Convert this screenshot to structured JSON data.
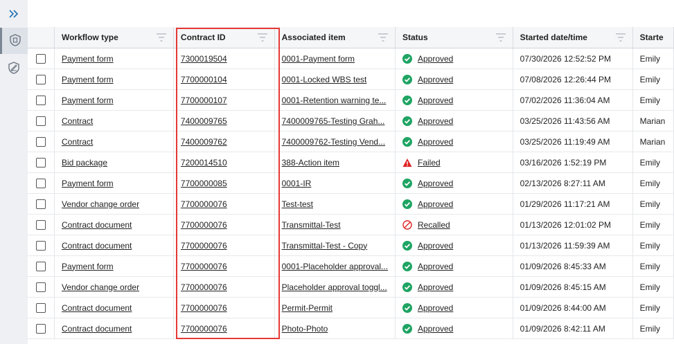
{
  "sidebar": {
    "expand_icon": "double-chevron-right-icon",
    "nav": [
      {
        "name": "workflow-nav",
        "icon": "shield-document-icon",
        "active": true
      },
      {
        "name": "sign-nav",
        "icon": "pen-signature-icon",
        "active": false
      }
    ]
  },
  "table": {
    "headers": {
      "workflow_type": "Workflow type",
      "contract_id": "Contract ID",
      "associated_item": "Associated item",
      "status": "Status",
      "started": "Started date/time",
      "started_by": "Starte"
    },
    "rows": [
      {
        "workflow_type": "Payment form",
        "contract_id": "7300019504",
        "associated_item": "0001-Payment form",
        "status": "Approved",
        "status_kind": "approved",
        "started": "07/30/2026 12:52:52 PM",
        "started_by": "Emily"
      },
      {
        "workflow_type": "Payment form",
        "contract_id": "7700000104",
        "associated_item": "0001-Locked WBS test",
        "status": "Approved",
        "status_kind": "approved",
        "started": "07/08/2026 12:26:44 PM",
        "started_by": "Emily"
      },
      {
        "workflow_type": "Payment form",
        "contract_id": "7700000107",
        "associated_item": "0001-Retention warning te...",
        "status": "Approved",
        "status_kind": "approved",
        "started": "07/02/2026 11:36:04 AM",
        "started_by": "Emily"
      },
      {
        "workflow_type": "Contract",
        "contract_id": "7400009765",
        "associated_item": "7400009765-Testing Grah...",
        "status": "Approved",
        "status_kind": "approved",
        "started": "03/25/2026 11:43:56 AM",
        "started_by": "Marian"
      },
      {
        "workflow_type": "Contract",
        "contract_id": "7400009762",
        "associated_item": "7400009762-Testing Vend...",
        "status": "Approved",
        "status_kind": "approved",
        "started": "03/25/2026 11:19:49 AM",
        "started_by": "Marian"
      },
      {
        "workflow_type": "Bid package",
        "contract_id": "7200014510",
        "associated_item": "388-Action item",
        "status": "Failed",
        "status_kind": "failed",
        "started": "03/16/2026 1:52:19 PM",
        "started_by": "Emily"
      },
      {
        "workflow_type": "Payment form",
        "contract_id": "7700000085",
        "associated_item": "0001-IR",
        "status": "Approved",
        "status_kind": "approved",
        "started": "02/13/2026 8:27:11 AM",
        "started_by": "Emily"
      },
      {
        "workflow_type": "Vendor change order",
        "contract_id": "7700000076",
        "associated_item": "Test-test",
        "status": "Approved",
        "status_kind": "approved",
        "started": "01/29/2026 11:17:21 AM",
        "started_by": "Emily"
      },
      {
        "workflow_type": "Contract document",
        "contract_id": "7700000076",
        "associated_item": "Transmittal-Test",
        "status": "Recalled",
        "status_kind": "recalled",
        "started": "01/13/2026 12:01:02 PM",
        "started_by": "Emily"
      },
      {
        "workflow_type": "Contract document",
        "contract_id": "7700000076",
        "associated_item": "Transmittal-Test - Copy",
        "status": "Approved",
        "status_kind": "approved",
        "started": "01/13/2026 11:59:39 AM",
        "started_by": "Emily"
      },
      {
        "workflow_type": "Payment form",
        "contract_id": "7700000076",
        "associated_item": "0001-Placeholder approval...",
        "status": "Approved",
        "status_kind": "approved",
        "started": "01/09/2026 8:45:33 AM",
        "started_by": "Emily"
      },
      {
        "workflow_type": "Vendor change order",
        "contract_id": "7700000076",
        "associated_item": "Placeholder approval toggl...",
        "status": "Approved",
        "status_kind": "approved",
        "started": "01/09/2026 8:45:15 AM",
        "started_by": "Emily"
      },
      {
        "workflow_type": "Contract document",
        "contract_id": "7700000076",
        "associated_item": "Permit-Permit",
        "status": "Approved",
        "status_kind": "approved",
        "started": "01/09/2026 8:44:00 AM",
        "started_by": "Emily"
      },
      {
        "workflow_type": "Contract document",
        "contract_id": "7700000076",
        "associated_item": "Photo-Photo",
        "status": "Approved",
        "status_kind": "approved",
        "started": "01/09/2026 8:42:11 AM",
        "started_by": "Emily"
      }
    ]
  },
  "colors": {
    "approved": "#1fa463",
    "failed": "#e02424",
    "recalled": "#e02424",
    "highlight": "#e53935",
    "accent": "#1f6fb2"
  }
}
